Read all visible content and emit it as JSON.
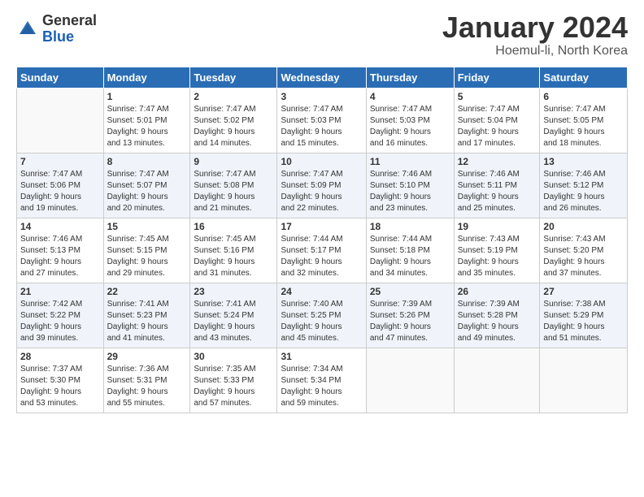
{
  "header": {
    "logo_general": "General",
    "logo_blue": "Blue",
    "month_title": "January 2024",
    "location": "Hoemul-li, North Korea"
  },
  "days_of_week": [
    "Sunday",
    "Monday",
    "Tuesday",
    "Wednesday",
    "Thursday",
    "Friday",
    "Saturday"
  ],
  "weeks": [
    {
      "days": [
        {
          "num": "",
          "info": ""
        },
        {
          "num": "1",
          "info": "Sunrise: 7:47 AM\nSunset: 5:01 PM\nDaylight: 9 hours\nand 13 minutes."
        },
        {
          "num": "2",
          "info": "Sunrise: 7:47 AM\nSunset: 5:02 PM\nDaylight: 9 hours\nand 14 minutes."
        },
        {
          "num": "3",
          "info": "Sunrise: 7:47 AM\nSunset: 5:03 PM\nDaylight: 9 hours\nand 15 minutes."
        },
        {
          "num": "4",
          "info": "Sunrise: 7:47 AM\nSunset: 5:03 PM\nDaylight: 9 hours\nand 16 minutes."
        },
        {
          "num": "5",
          "info": "Sunrise: 7:47 AM\nSunset: 5:04 PM\nDaylight: 9 hours\nand 17 minutes."
        },
        {
          "num": "6",
          "info": "Sunrise: 7:47 AM\nSunset: 5:05 PM\nDaylight: 9 hours\nand 18 minutes."
        }
      ]
    },
    {
      "days": [
        {
          "num": "7",
          "info": "Sunrise: 7:47 AM\nSunset: 5:06 PM\nDaylight: 9 hours\nand 19 minutes."
        },
        {
          "num": "8",
          "info": "Sunrise: 7:47 AM\nSunset: 5:07 PM\nDaylight: 9 hours\nand 20 minutes."
        },
        {
          "num": "9",
          "info": "Sunrise: 7:47 AM\nSunset: 5:08 PM\nDaylight: 9 hours\nand 21 minutes."
        },
        {
          "num": "10",
          "info": "Sunrise: 7:47 AM\nSunset: 5:09 PM\nDaylight: 9 hours\nand 22 minutes."
        },
        {
          "num": "11",
          "info": "Sunrise: 7:46 AM\nSunset: 5:10 PM\nDaylight: 9 hours\nand 23 minutes."
        },
        {
          "num": "12",
          "info": "Sunrise: 7:46 AM\nSunset: 5:11 PM\nDaylight: 9 hours\nand 25 minutes."
        },
        {
          "num": "13",
          "info": "Sunrise: 7:46 AM\nSunset: 5:12 PM\nDaylight: 9 hours\nand 26 minutes."
        }
      ]
    },
    {
      "days": [
        {
          "num": "14",
          "info": "Sunrise: 7:46 AM\nSunset: 5:13 PM\nDaylight: 9 hours\nand 27 minutes."
        },
        {
          "num": "15",
          "info": "Sunrise: 7:45 AM\nSunset: 5:15 PM\nDaylight: 9 hours\nand 29 minutes."
        },
        {
          "num": "16",
          "info": "Sunrise: 7:45 AM\nSunset: 5:16 PM\nDaylight: 9 hours\nand 31 minutes."
        },
        {
          "num": "17",
          "info": "Sunrise: 7:44 AM\nSunset: 5:17 PM\nDaylight: 9 hours\nand 32 minutes."
        },
        {
          "num": "18",
          "info": "Sunrise: 7:44 AM\nSunset: 5:18 PM\nDaylight: 9 hours\nand 34 minutes."
        },
        {
          "num": "19",
          "info": "Sunrise: 7:43 AM\nSunset: 5:19 PM\nDaylight: 9 hours\nand 35 minutes."
        },
        {
          "num": "20",
          "info": "Sunrise: 7:43 AM\nSunset: 5:20 PM\nDaylight: 9 hours\nand 37 minutes."
        }
      ]
    },
    {
      "days": [
        {
          "num": "21",
          "info": "Sunrise: 7:42 AM\nSunset: 5:22 PM\nDaylight: 9 hours\nand 39 minutes."
        },
        {
          "num": "22",
          "info": "Sunrise: 7:41 AM\nSunset: 5:23 PM\nDaylight: 9 hours\nand 41 minutes."
        },
        {
          "num": "23",
          "info": "Sunrise: 7:41 AM\nSunset: 5:24 PM\nDaylight: 9 hours\nand 43 minutes."
        },
        {
          "num": "24",
          "info": "Sunrise: 7:40 AM\nSunset: 5:25 PM\nDaylight: 9 hours\nand 45 minutes."
        },
        {
          "num": "25",
          "info": "Sunrise: 7:39 AM\nSunset: 5:26 PM\nDaylight: 9 hours\nand 47 minutes."
        },
        {
          "num": "26",
          "info": "Sunrise: 7:39 AM\nSunset: 5:28 PM\nDaylight: 9 hours\nand 49 minutes."
        },
        {
          "num": "27",
          "info": "Sunrise: 7:38 AM\nSunset: 5:29 PM\nDaylight: 9 hours\nand 51 minutes."
        }
      ]
    },
    {
      "days": [
        {
          "num": "28",
          "info": "Sunrise: 7:37 AM\nSunset: 5:30 PM\nDaylight: 9 hours\nand 53 minutes."
        },
        {
          "num": "29",
          "info": "Sunrise: 7:36 AM\nSunset: 5:31 PM\nDaylight: 9 hours\nand 55 minutes."
        },
        {
          "num": "30",
          "info": "Sunrise: 7:35 AM\nSunset: 5:33 PM\nDaylight: 9 hours\nand 57 minutes."
        },
        {
          "num": "31",
          "info": "Sunrise: 7:34 AM\nSunset: 5:34 PM\nDaylight: 9 hours\nand 59 minutes."
        },
        {
          "num": "",
          "info": ""
        },
        {
          "num": "",
          "info": ""
        },
        {
          "num": "",
          "info": ""
        }
      ]
    }
  ]
}
